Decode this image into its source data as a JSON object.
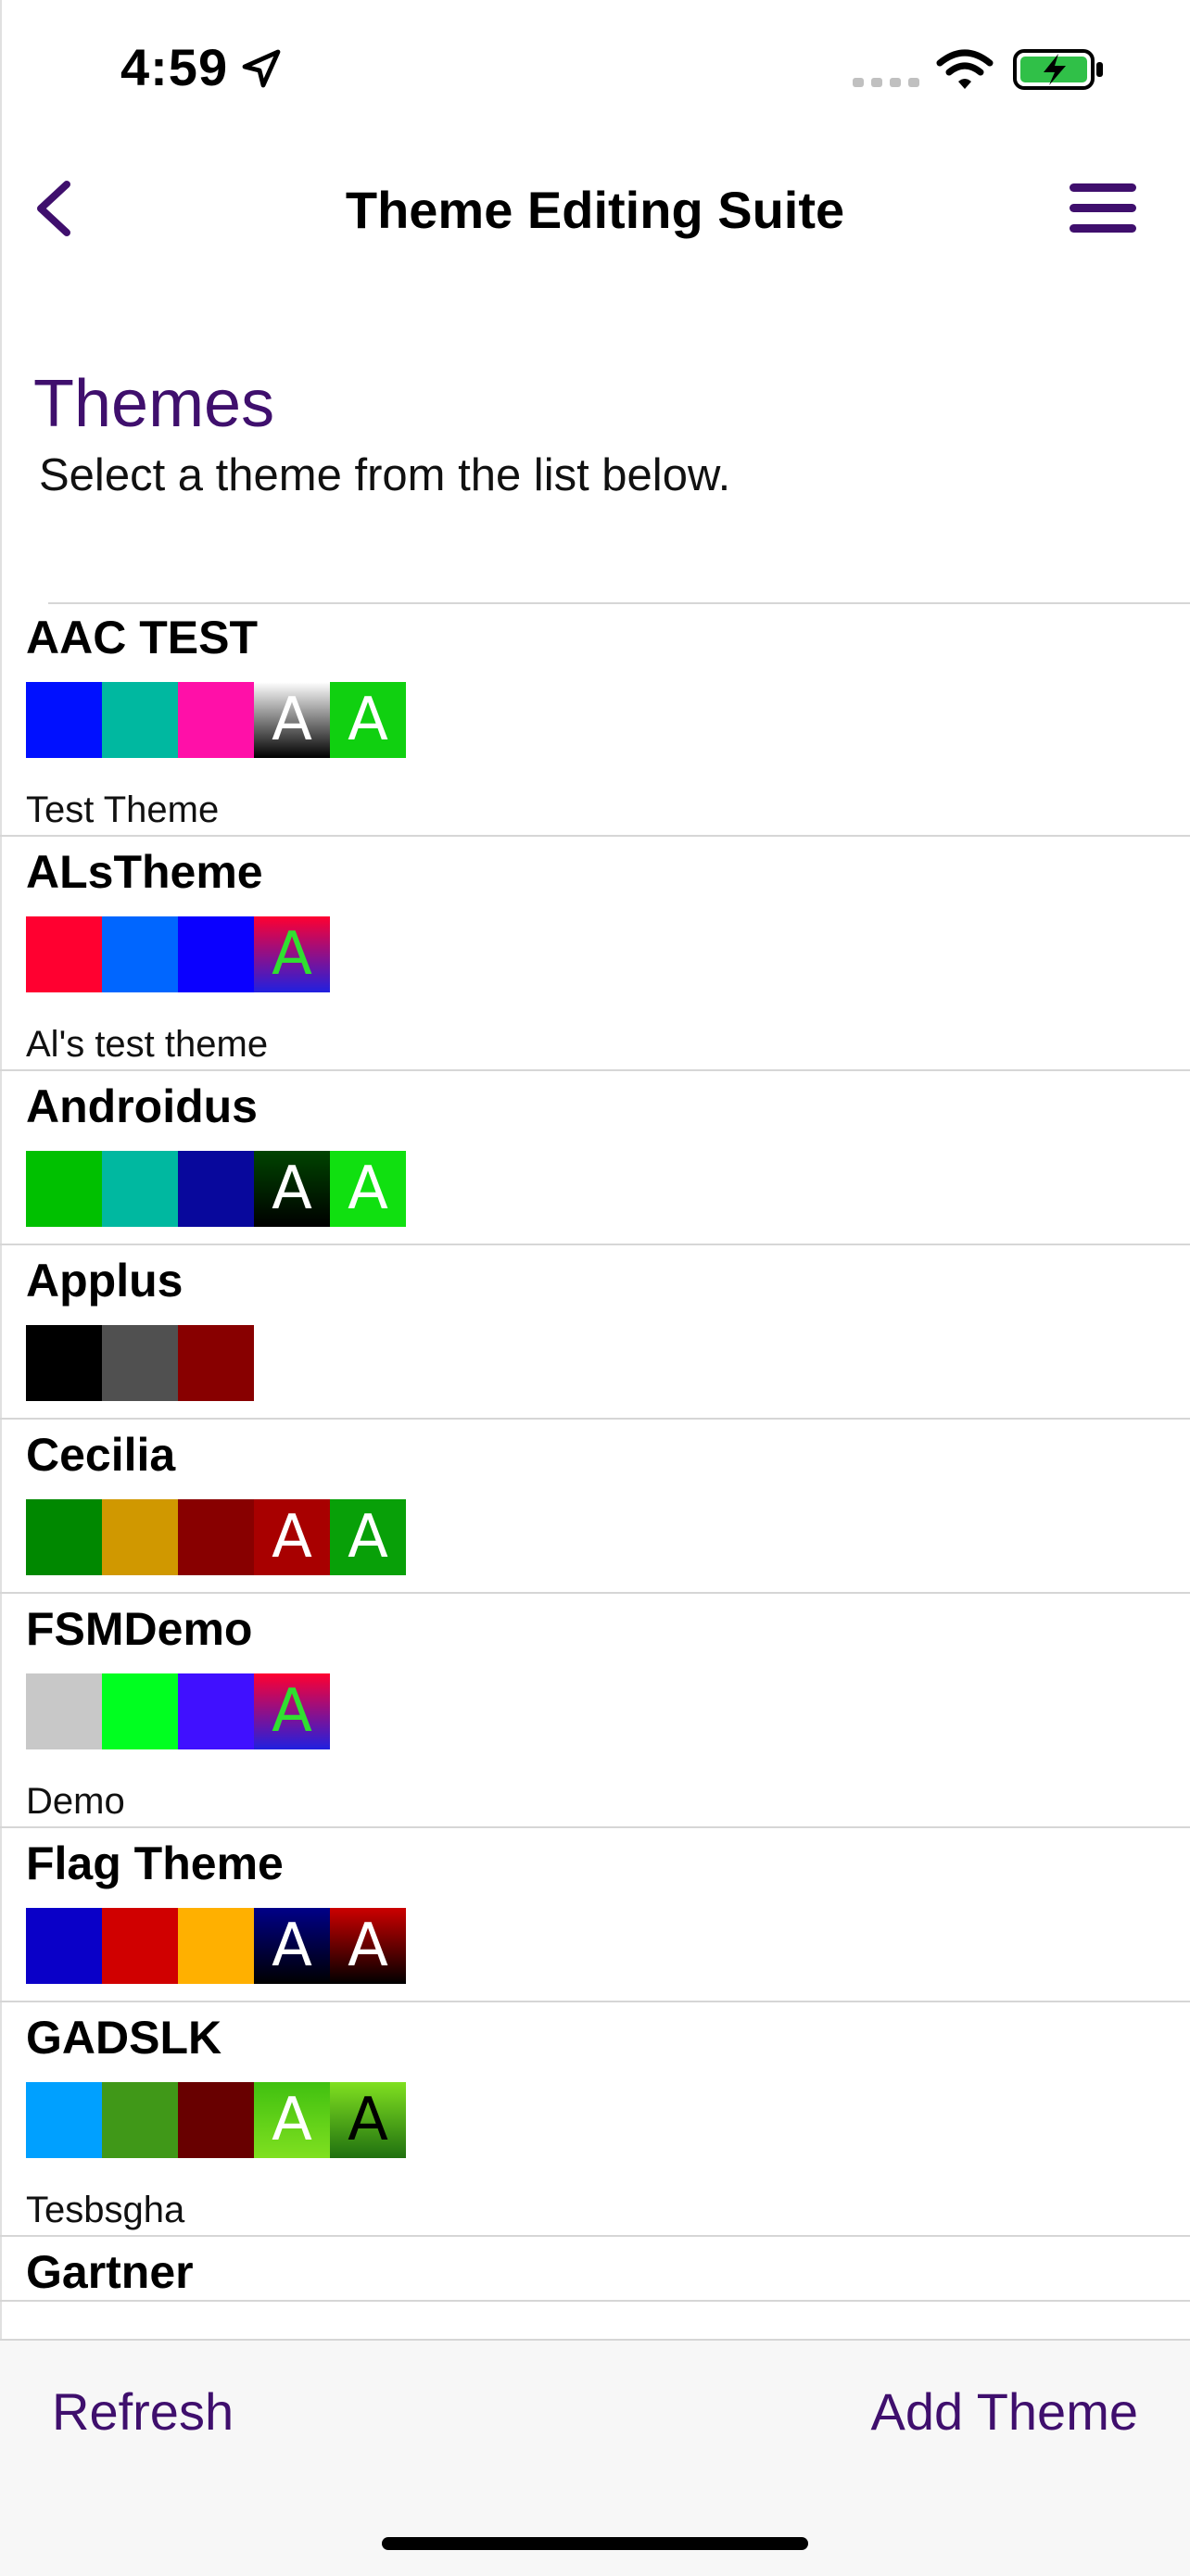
{
  "status_bar": {
    "time": "4:59"
  },
  "nav": {
    "title": "Theme Editing Suite"
  },
  "page": {
    "heading": "Themes",
    "subtitle": "Select a theme from the list below."
  },
  "themes": [
    {
      "name": "AAC TEST",
      "description": "Test Theme",
      "swatches": [
        {
          "bg": "#0010ff"
        },
        {
          "bg": "#00b8a0"
        },
        {
          "bg": "#ff10a8"
        },
        {
          "bg": "linear-gradient(#ffffff,#000000)",
          "letter": "A",
          "fg": "#ffffff"
        },
        {
          "bg": "#10d010",
          "letter": "A",
          "fg": "#ffffff"
        }
      ]
    },
    {
      "name": "ALsTheme",
      "description": "Al's test theme",
      "swatches": [
        {
          "bg": "#ff0030"
        },
        {
          "bg": "#0066ff"
        },
        {
          "bg": "#0a00ff"
        },
        {
          "bg": "linear-gradient(#ff0030,#2020e0)",
          "letter": "A",
          "fg": "#30e030"
        }
      ]
    },
    {
      "name": "Androidus",
      "description": "",
      "swatches": [
        {
          "bg": "#00c000"
        },
        {
          "bg": "#00b8a0"
        },
        {
          "bg": "#08089c"
        },
        {
          "bg": "linear-gradient(#004400,#000000)",
          "letter": "A",
          "fg": "#ffffff"
        },
        {
          "bg": "#10e010",
          "letter": "A",
          "fg": "#ffffff"
        }
      ]
    },
    {
      "name": "Applus",
      "description": "",
      "swatches": [
        {
          "bg": "#000000"
        },
        {
          "bg": "#505050"
        },
        {
          "bg": "#880000"
        }
      ]
    },
    {
      "name": "Cecilia",
      "description": "",
      "swatches": [
        {
          "bg": "#008800"
        },
        {
          "bg": "#d09800"
        },
        {
          "bg": "#880000"
        },
        {
          "bg": "#a80000",
          "letter": "A",
          "fg": "#ffffff"
        },
        {
          "bg": "#08a008",
          "letter": "A",
          "fg": "#ffffff"
        }
      ]
    },
    {
      "name": "FSMDemo",
      "description": "Demo",
      "swatches": [
        {
          "bg": "#c8c8c8"
        },
        {
          "bg": "#00ff20"
        },
        {
          "bg": "#4010ff"
        },
        {
          "bg": "linear-gradient(#ff0030,#2020e0)",
          "letter": "A",
          "fg": "#30e030"
        }
      ]
    },
    {
      "name": "Flag Theme",
      "description": "",
      "swatches": [
        {
          "bg": "#0a00c8"
        },
        {
          "bg": "#d00000"
        },
        {
          "bg": "#ffb000"
        },
        {
          "bg": "linear-gradient(#000088,#000000)",
          "letter": "A",
          "fg": "#ffffff"
        },
        {
          "bg": "linear-gradient(#cc0000,#000000)",
          "letter": "A",
          "fg": "#ffffff"
        }
      ]
    },
    {
      "name": "GADSLK",
      "description": "Tesbsgha",
      "swatches": [
        {
          "bg": "#00a0ff"
        },
        {
          "bg": "#409818"
        },
        {
          "bg": "#680000"
        },
        {
          "bg": "linear-gradient(#40c010,#80e020)",
          "letter": "A",
          "fg": "#ffffff"
        },
        {
          "bg": "linear-gradient(#80e020,#207010)",
          "letter": "A",
          "fg": "#000000"
        }
      ]
    },
    {
      "name": "Gartner",
      "description": "",
      "swatches": []
    }
  ],
  "toolbar": {
    "refresh_label": "Refresh",
    "add_label": "Add Theme"
  },
  "colors": {
    "accent": "#3f0f6d"
  }
}
